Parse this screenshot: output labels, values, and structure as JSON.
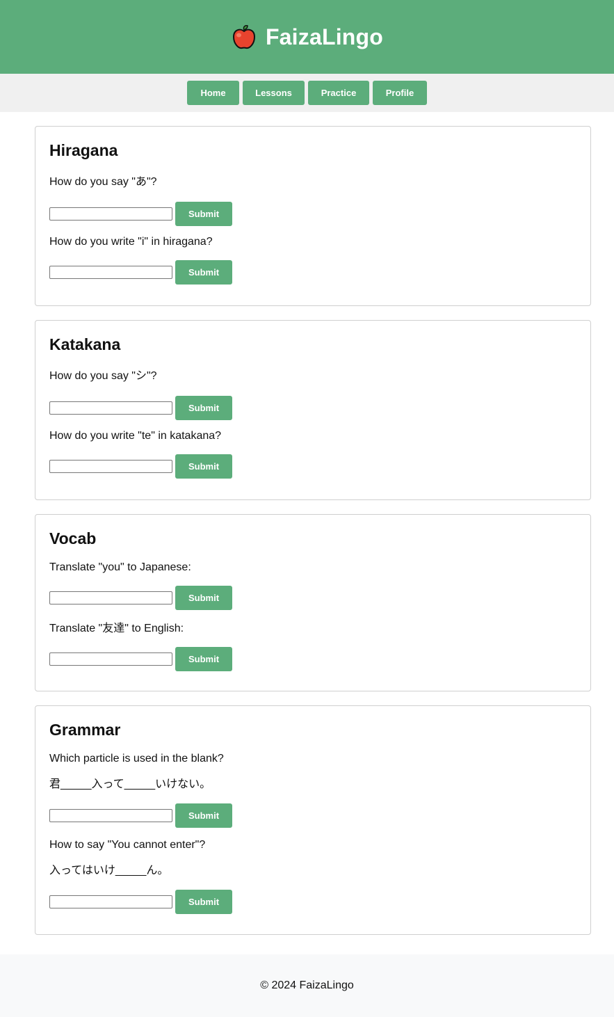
{
  "header": {
    "title": "FaizaLingo",
    "logo_icon": "apple-icon",
    "background": "#5cad7b"
  },
  "nav": {
    "items": [
      {
        "label": "Home"
      },
      {
        "label": "Lessons"
      },
      {
        "label": "Practice"
      },
      {
        "label": "Profile"
      }
    ]
  },
  "sections": {
    "hiragana": {
      "title": "Hiragana",
      "questions": [
        {
          "text": "How do you say \"あ\"?",
          "value": "",
          "submit_label": "Submit"
        },
        {
          "text": "How do you write \"i\" in hiragana?",
          "value": "",
          "submit_label": "Submit"
        }
      ]
    },
    "katakana": {
      "title": "Katakana",
      "questions": [
        {
          "text": "How do you say \"シ\"?",
          "value": "",
          "submit_label": "Submit"
        },
        {
          "text": "How do you write \"te\" in katakana?",
          "value": "",
          "submit_label": "Submit"
        }
      ]
    },
    "vocab": {
      "title": "Vocab",
      "questions": [
        {
          "text": "Translate \"you\" to Japanese:",
          "value": "",
          "submit_label": "Submit"
        },
        {
          "text": "Translate \"友達\" to English:",
          "value": "",
          "submit_label": "Submit"
        }
      ]
    },
    "grammar": {
      "title": "Grammar",
      "questions": [
        {
          "text": "Which particle is used in the blank?",
          "example": "君_____入って_____いけない。",
          "value": "",
          "submit_label": "Submit"
        },
        {
          "text": "How to say \"You cannot enter\"?",
          "example": "入ってはいけ_____ん。",
          "value": "",
          "submit_label": "Submit"
        }
      ]
    }
  },
  "footer": {
    "text": "© 2024 FaizaLingo"
  },
  "colors": {
    "accent": "#5cad7b",
    "nav_bg": "#f0f0f0",
    "footer_bg": "#f8f9fa",
    "card_border": "#cfcfcf"
  }
}
